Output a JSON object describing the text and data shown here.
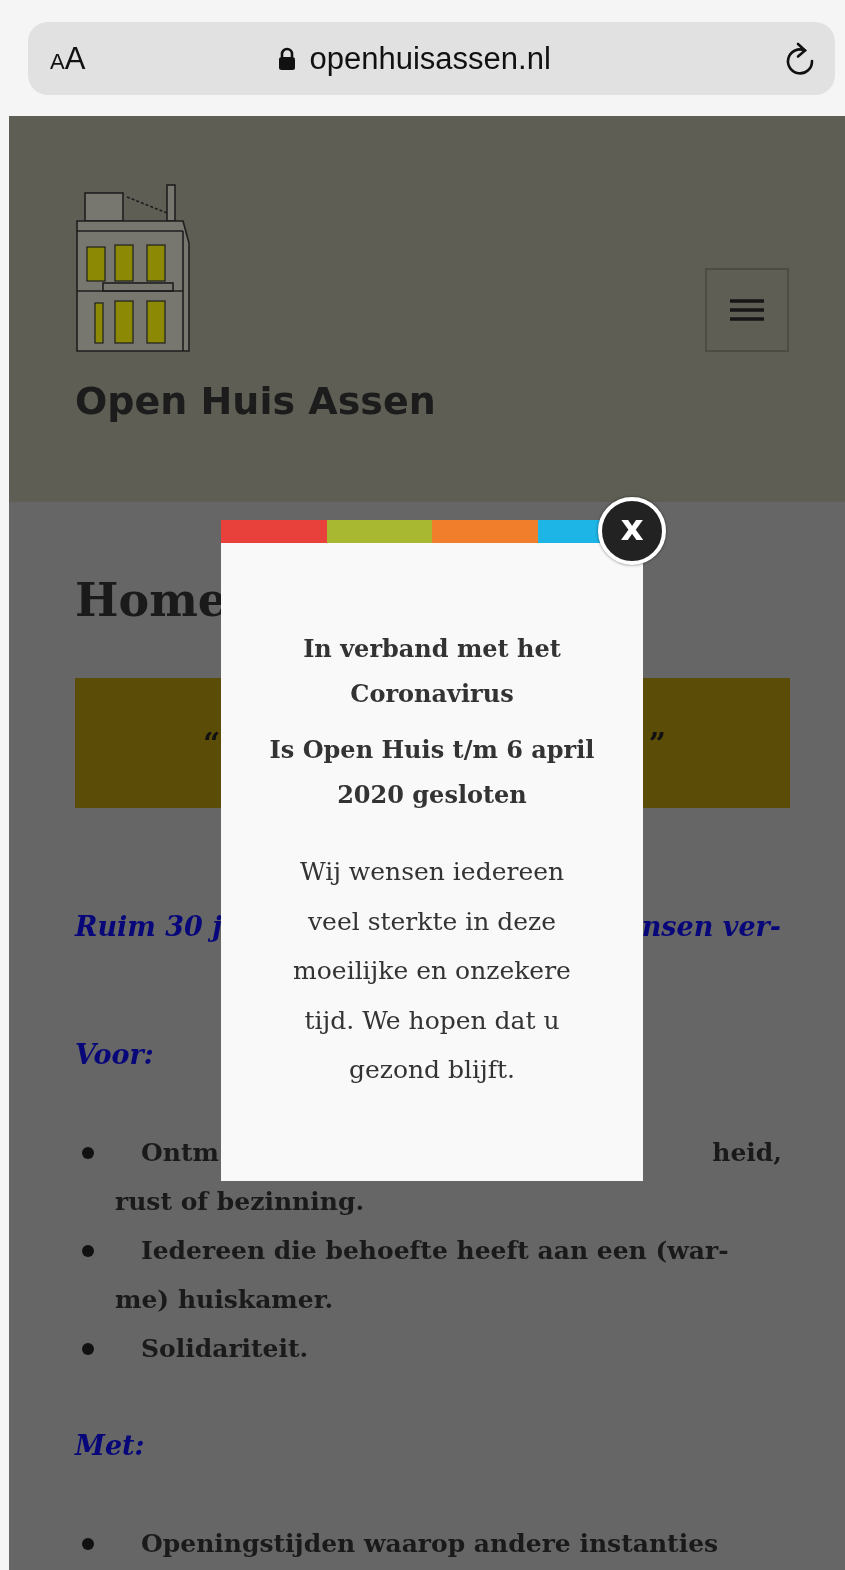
{
  "browser": {
    "text_size_label": "AA",
    "url": "openhuisassen.nl"
  },
  "site": {
    "title": "Open Huis Assen"
  },
  "page": {
    "heading": "Home",
    "quote_box": {
      "open_quote": "“",
      "close_quote": "”"
    },
    "intro": {
      "left": "Ruim 30 j",
      "right": "nsen ver-"
    },
    "sections": [
      {
        "label": "Voor:",
        "items": [
          {
            "lines": [
              [
                "Ontm",
                "heid,"
              ],
              [
                "rust of bezinning."
              ]
            ]
          },
          {
            "lines": [
              [
                "Iedereen die behoefte heeft aan een (war-"
              ],
              [
                "me) huiskamer."
              ]
            ]
          },
          {
            "lines": [
              [
                "Solidariteit."
              ]
            ]
          }
        ]
      },
      {
        "label": "Met:",
        "items": [
          {
            "lines": [
              [
                "Openingstijden waarop andere instanties"
              ]
            ]
          }
        ]
      }
    ]
  },
  "popup": {
    "close_label": "x",
    "headings": [
      "In verband met het Coronavirus",
      "Is Open Huis t/m 6 april 2020 gesloten"
    ],
    "message": "Wij wensen iedereen veel sterkte in deze moeilijke en onzekere tijd. We hopen dat u gezond blijft."
  }
}
